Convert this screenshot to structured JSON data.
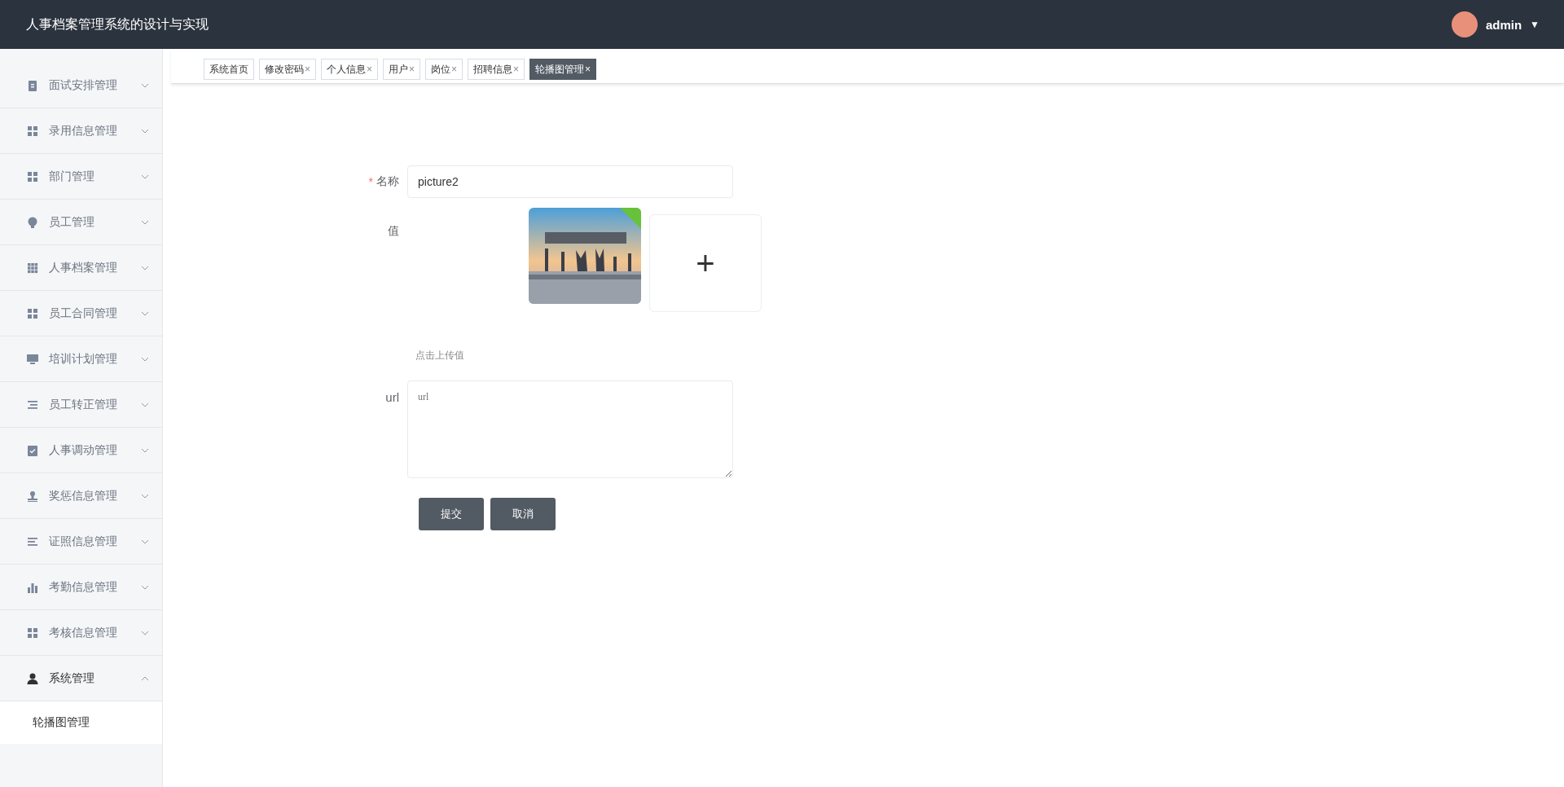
{
  "header": {
    "title": "人事档案管理系统的设计与实现",
    "user": {
      "name": "admin",
      "caret": "▼"
    }
  },
  "sidebar": {
    "items": [
      {
        "label": "面试安排管理",
        "expanded": false
      },
      {
        "label": "录用信息管理",
        "expanded": false
      },
      {
        "label": "部门管理",
        "expanded": false
      },
      {
        "label": "员工管理",
        "expanded": false
      },
      {
        "label": "人事档案管理",
        "expanded": false
      },
      {
        "label": "员工合同管理",
        "expanded": false
      },
      {
        "label": "培训计划管理",
        "expanded": false
      },
      {
        "label": "员工转正管理",
        "expanded": false
      },
      {
        "label": "人事调动管理",
        "expanded": false
      },
      {
        "label": "奖惩信息管理",
        "expanded": false
      },
      {
        "label": "证照信息管理",
        "expanded": false
      },
      {
        "label": "考勤信息管理",
        "expanded": false
      },
      {
        "label": "考核信息管理",
        "expanded": false
      },
      {
        "label": "系统管理",
        "expanded": true,
        "children": [
          {
            "label": "轮播图管理",
            "selected": true
          }
        ]
      }
    ]
  },
  "tabs": [
    {
      "label": "系统首页",
      "selected": false
    },
    {
      "label": "修改密码",
      "close": "×",
      "selected": false
    },
    {
      "label": "个人信息",
      "close": "×",
      "selected": false
    },
    {
      "label": "用户",
      "close": "×",
      "selected": false
    },
    {
      "label": "岗位",
      "close": "×",
      "selected": false
    },
    {
      "label": "招聘信息",
      "close": "×",
      "selected": false
    },
    {
      "label": "轮播图管理",
      "close": "×",
      "selected": true
    }
  ],
  "form": {
    "name": {
      "label": "名称",
      "required_mark": "*",
      "value": "picture2"
    },
    "value": {
      "label": "值",
      "upload": {
        "kind": "picture",
        "uploaded": true,
        "add": "+"
      },
      "hint": "点击上传值"
    },
    "url": {
      "label": "url",
      "placeholder": "url"
    },
    "buttons": [
      "提交",
      "取消"
    ]
  }
}
